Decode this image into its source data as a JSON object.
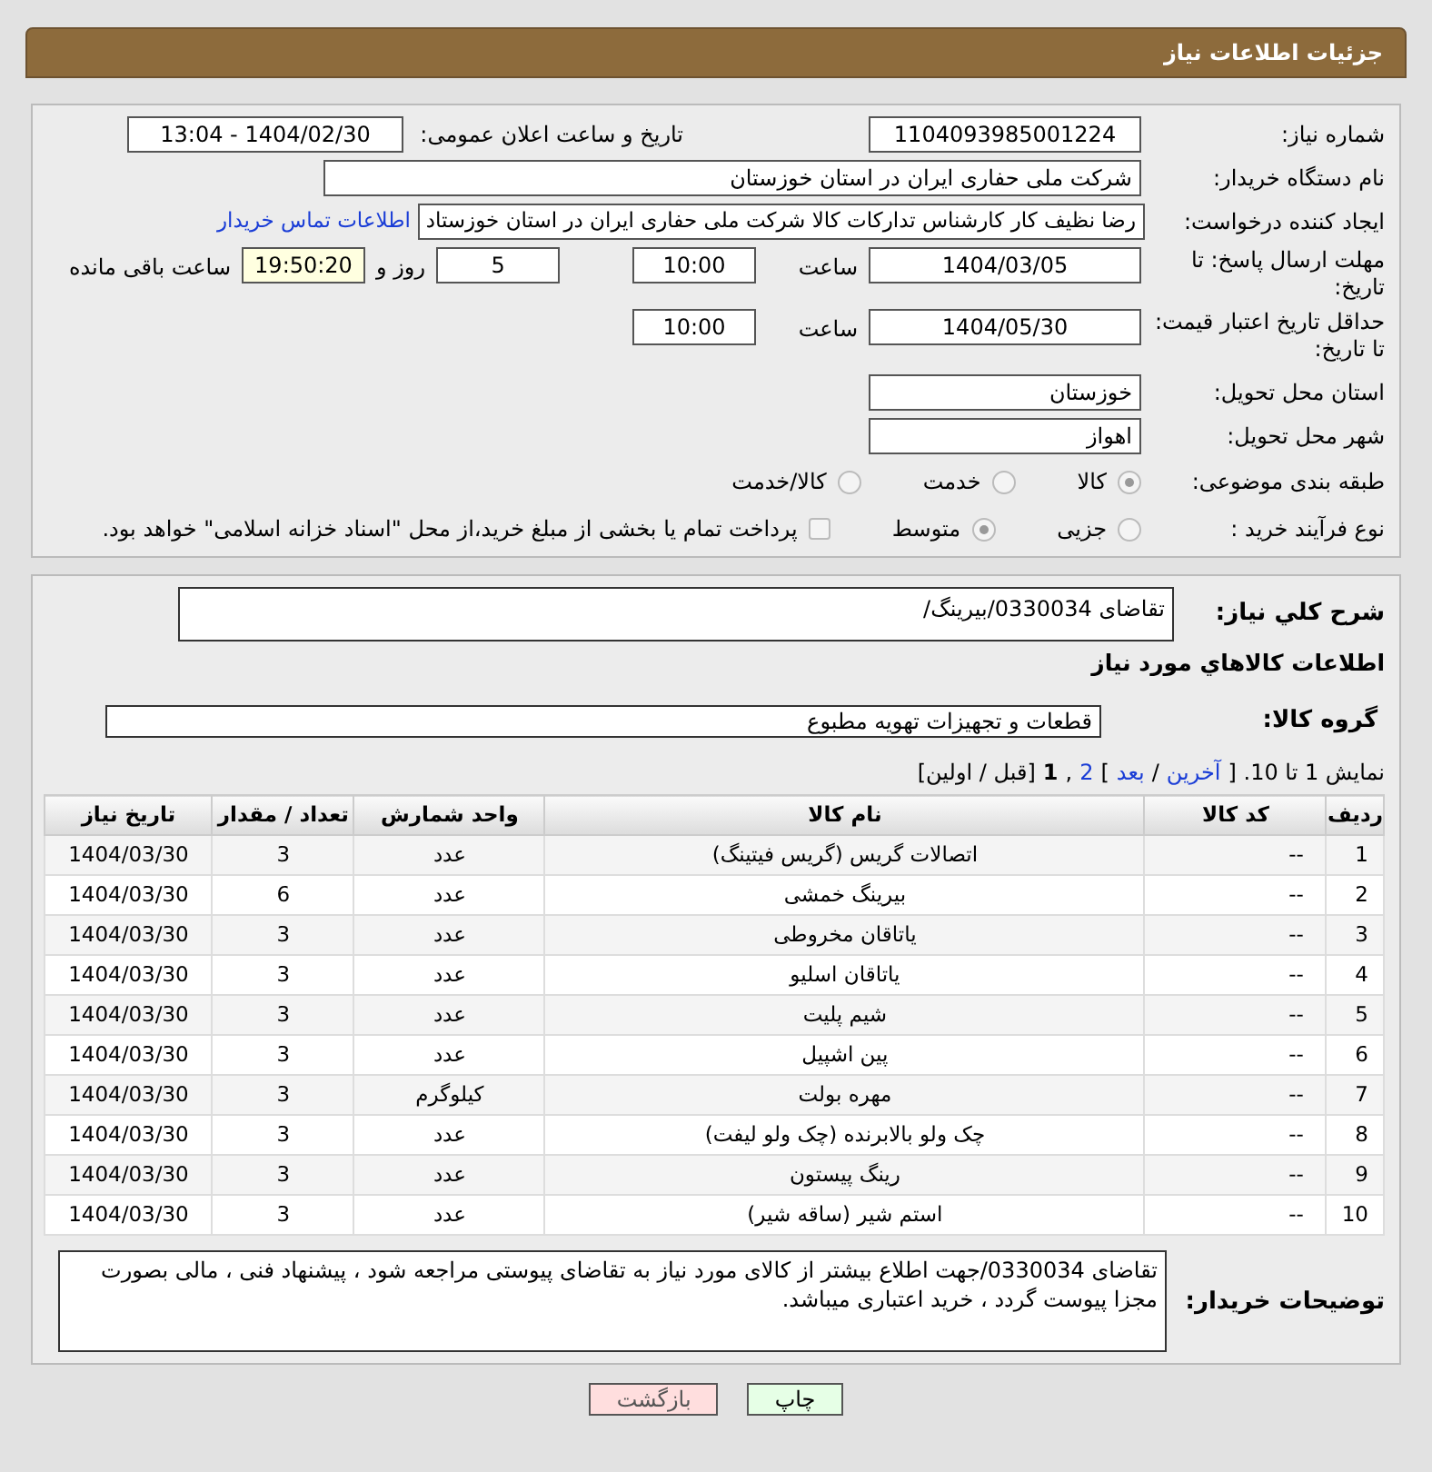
{
  "header": {
    "title": "جزئیات اطلاعات نیاز"
  },
  "need_number": {
    "label": "شماره نیاز:",
    "value": "1104093985001224"
  },
  "announce": {
    "label": "تاریخ و ساعت اعلان عمومی:",
    "value": "1404/02/30 - 13:04"
  },
  "buyer_org": {
    "label": "نام دستگاه خریدار:",
    "value": "شرکت ملی حفاری ایران در استان خوزستان"
  },
  "requester": {
    "label": "ایجاد کننده درخواست:",
    "value": "رضا نظیف کار کارشناس تدارکات کالا شرکت ملی حفاری ایران در استان خوزستاد",
    "link": "اطلاعات تماس خریدار"
  },
  "deadline": {
    "label": "مهلت ارسال پاسخ: تا تاریخ:",
    "date": "1404/03/05",
    "time_label": "ساعت",
    "time": "10:00",
    "days": "5",
    "days_label": "روز و",
    "remaining": "19:50:20",
    "remaining_label": "ساعت باقی مانده"
  },
  "validity": {
    "label": "حداقل تاریخ اعتبار قیمت: تا تاریخ:",
    "date": "1404/05/30",
    "time_label": "ساعت",
    "time": "10:00"
  },
  "province": {
    "label": "استان محل تحویل:",
    "value": "خوزستان"
  },
  "city": {
    "label": "شهر محل تحویل:",
    "value": "اهواز"
  },
  "category": {
    "label": "طبقه بندی موضوعی:",
    "options": [
      {
        "label": "کالا",
        "selected": true
      },
      {
        "label": "خدمت",
        "selected": false
      },
      {
        "label": "کالا/خدمت",
        "selected": false
      }
    ]
  },
  "purchase_type": {
    "label": "نوع فرآیند خرید :",
    "options": [
      {
        "label": "جزیی",
        "selected": false
      },
      {
        "label": "متوسط",
        "selected": true
      }
    ],
    "payment_note": {
      "label": "پرداخت تمام یا بخشی از مبلغ خرید،از محل \"اسناد خزانه اسلامی\" خواهد بود.",
      "checked": false
    }
  },
  "description": {
    "label": "شرح کلي نياز:",
    "value": "تقاضای 0330034/بیرینگ/"
  },
  "goods_heading": "اطلاعات کالاهاي مورد نياز",
  "goods_group": {
    "label": "گروه کالا:",
    "value": "قطعات و تجهیزات تهویه مطبوع"
  },
  "pagination": [
    {
      "kind": "text",
      "text": "نمایش 1 تا 10. ["
    },
    {
      "kind": "link",
      "text": "آخرین"
    },
    {
      "kind": "text",
      "text": "/"
    },
    {
      "kind": "link",
      "text": "بعد"
    },
    {
      "kind": "text",
      "text": "]"
    },
    {
      "kind": "link",
      "text": "2"
    },
    {
      "kind": "text",
      "text": ","
    },
    {
      "kind": "bold",
      "text": "1"
    },
    {
      "kind": "text",
      "text": "[قبل / اولین]"
    }
  ],
  "table": {
    "columns": [
      "ردیف",
      "کد کالا",
      "نام کالا",
      "واحد شمارش",
      "تعداد / مقدار",
      "تاریخ نیاز"
    ],
    "rows": [
      [
        "1",
        "--",
        "اتصالات گریس (گریس فیتینگ)",
        "عدد",
        "3",
        "1404/03/30"
      ],
      [
        "2",
        "--",
        "بیرینگ خمشی",
        "عدد",
        "6",
        "1404/03/30"
      ],
      [
        "3",
        "--",
        "یاتاقان مخروطی",
        "عدد",
        "3",
        "1404/03/30"
      ],
      [
        "4",
        "--",
        "یاتاقان اسلیو",
        "عدد",
        "3",
        "1404/03/30"
      ],
      [
        "5",
        "--",
        "شیم پلیت",
        "عدد",
        "3",
        "1404/03/30"
      ],
      [
        "6",
        "--",
        "پین اشپیل",
        "عدد",
        "3",
        "1404/03/30"
      ],
      [
        "7",
        "--",
        "مهره بولت",
        "کیلوگرم",
        "3",
        "1404/03/30"
      ],
      [
        "8",
        "--",
        "چک ولو بالابرنده (چک ولو لیفت)",
        "عدد",
        "3",
        "1404/03/30"
      ],
      [
        "9",
        "--",
        "رینگ پیستون",
        "عدد",
        "3",
        "1404/03/30"
      ],
      [
        "10",
        "--",
        "استم شیر (ساقه شیر)",
        "عدد",
        "3",
        "1404/03/30"
      ]
    ]
  },
  "buyer_notes": {
    "label": "توضیحات خریدار:",
    "value": "تقاضای 0330034/جهت اطلاع بیشتر از کالای مورد نیاز به تقاضای پیوستی مراجعه شود ، پیشنهاد فنی ، مالی بصورت مجزا پیوست گردد ، خرید اعتباری میباشد."
  },
  "buttons": [
    {
      "kind": "print",
      "label": "چاپ"
    },
    {
      "kind": "back",
      "label": "بازگشت"
    }
  ]
}
